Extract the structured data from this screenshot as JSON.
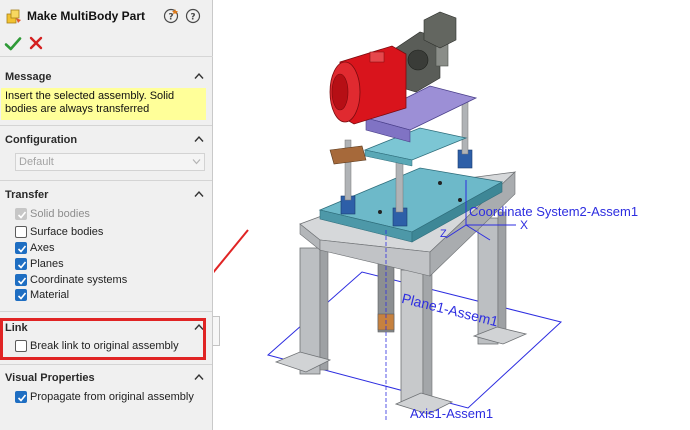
{
  "panel": {
    "title": "Make MultiBody Part",
    "sections": {
      "message": {
        "header": "Message",
        "text_line1": "Insert the selected assembly. Solid",
        "text_line2": "bodies are always transferred"
      },
      "configuration": {
        "header": "Configuration",
        "selected": "Default"
      },
      "transfer": {
        "header": "Transfer",
        "options": [
          {
            "label": "Solid bodies",
            "checked": true,
            "disabled": true
          },
          {
            "label": "Surface bodies",
            "checked": false,
            "disabled": false
          },
          {
            "label": "Axes",
            "checked": true,
            "disabled": false
          },
          {
            "label": "Planes",
            "checked": true,
            "disabled": false
          },
          {
            "label": "Coordinate systems",
            "checked": true,
            "disabled": false
          },
          {
            "label": "Material",
            "checked": true,
            "disabled": false
          }
        ]
      },
      "link": {
        "header": "Link",
        "break_link": {
          "label": "Break link to original assembly",
          "checked": false
        }
      },
      "visual_properties": {
        "header": "Visual Properties",
        "propagate": {
          "label": "Propagate from original assembly",
          "checked": true
        }
      }
    }
  },
  "viewport": {
    "coordinate_system_label": "Coordinate System2-Assem1",
    "axis_x_label": "X",
    "axis_z_label": "Z",
    "plane_label": "Plane1-Assem1",
    "axis_label": "Axis1-Assem1"
  },
  "colors": {
    "highlight": "#e02424",
    "check_blue": "#1e6ec2",
    "message_bg": "#ffff99",
    "annotation_blue": "#2d2de0",
    "motor_red": "#d9141c",
    "plate_teal": "#6db9c9",
    "plate_purple": "#9c8fd6",
    "frame_gray": "#c7c9cb"
  }
}
